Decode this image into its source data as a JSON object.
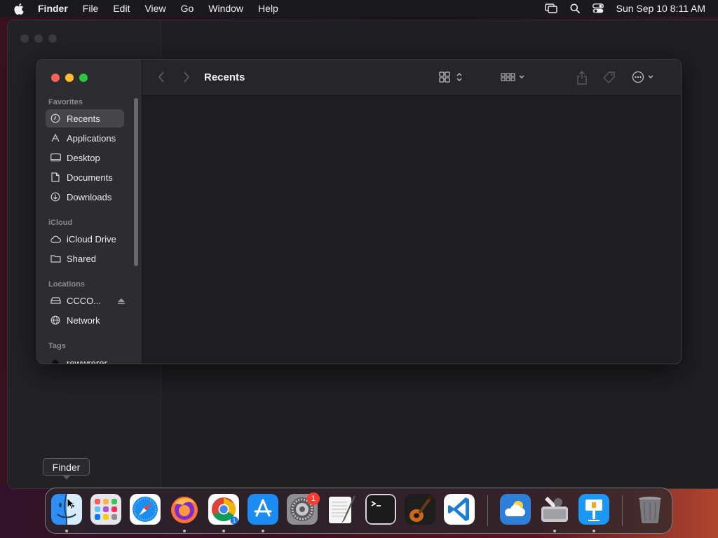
{
  "menubar": {
    "app_name": "Finder",
    "items": [
      "File",
      "Edit",
      "View",
      "Go",
      "Window",
      "Help"
    ],
    "clock": "Sun Sep 10  8:11 AM"
  },
  "finder": {
    "title": "Recents",
    "sidebar": {
      "favorites_header": "Favorites",
      "favorites": [
        {
          "label": "Recents",
          "icon": "clock-icon",
          "selected": true
        },
        {
          "label": "Applications",
          "icon": "applications-icon"
        },
        {
          "label": "Desktop",
          "icon": "desktop-icon"
        },
        {
          "label": "Documents",
          "icon": "document-icon"
        },
        {
          "label": "Downloads",
          "icon": "download-icon"
        }
      ],
      "icloud_header": "iCloud",
      "icloud": [
        {
          "label": "iCloud Drive",
          "icon": "cloud-icon"
        },
        {
          "label": "Shared",
          "icon": "shared-folder-icon"
        }
      ],
      "locations_header": "Locations",
      "locations": [
        {
          "label": "CCCO...",
          "icon": "drive-icon"
        },
        {
          "label": "Network",
          "icon": "network-icon"
        }
      ],
      "tags_header": "Tags",
      "tags": [
        {
          "label": "rewwrerer",
          "icon": "tag-dot-icon"
        }
      ]
    }
  },
  "tooltip": "Finder",
  "dock": {
    "apps": [
      "Finder",
      "Launchpad",
      "Safari",
      "Firefox",
      "Chrome",
      "App Store",
      "System Settings",
      "TextEdit",
      "Terminal",
      "GarageBand",
      "Visual Studio Code",
      "Weather",
      "Disk Utility",
      "Keynote",
      "Trash"
    ],
    "system_settings_badge": "1",
    "chrome_badge": "1"
  },
  "colors": {
    "accent": "#0a84ff",
    "close": "#fe5f57",
    "minimize": "#febc2e",
    "zoom": "#28c840"
  }
}
